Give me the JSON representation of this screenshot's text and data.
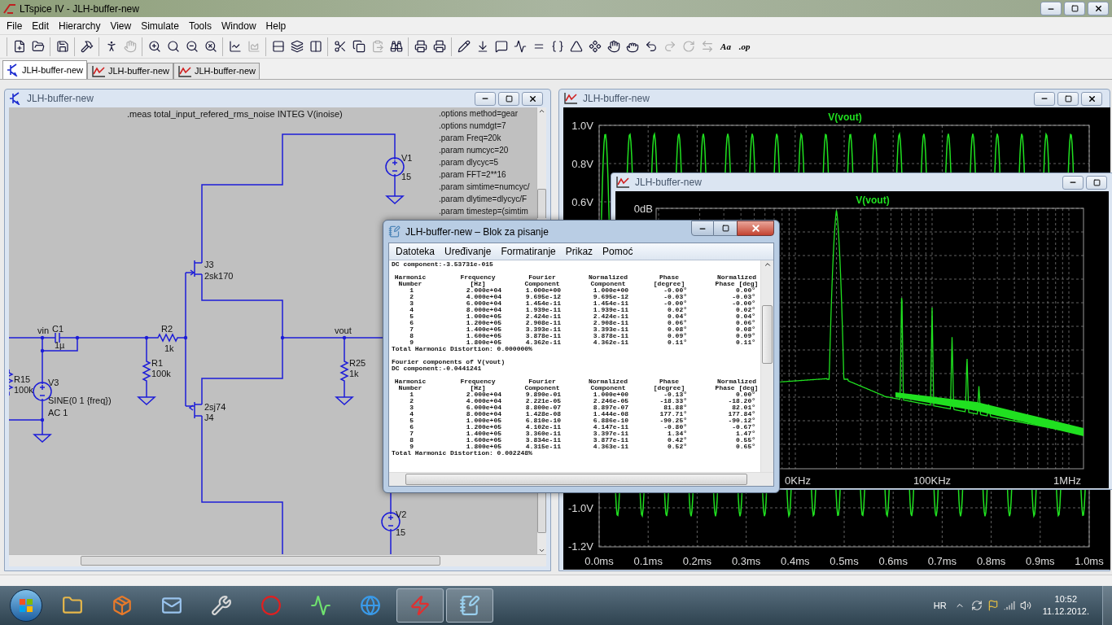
{
  "app_window": {
    "title": "LTspice IV - JLH-buffer-new"
  },
  "menu": [
    "File",
    "Edit",
    "Hierarchy",
    "View",
    "Simulate",
    "Tools",
    "Window",
    "Help"
  ],
  "toolbar_groups": [
    [
      {
        "kind": "new",
        "disabled": false
      },
      {
        "kind": "open",
        "disabled": false
      }
    ],
    [
      {
        "kind": "save",
        "disabled": false
      }
    ],
    [
      {
        "kind": "hammer",
        "disabled": false
      }
    ],
    [
      {
        "kind": "run",
        "disabled": false
      },
      {
        "kind": "halt",
        "disabled": true
      }
    ],
    [
      {
        "kind": "zoom_in",
        "disabled": false
      },
      {
        "kind": "pan",
        "disabled": false
      },
      {
        "kind": "zoom_out",
        "disabled": false
      },
      {
        "kind": "zoom_cancel",
        "disabled": false
      }
    ],
    [
      {
        "kind": "autorange",
        "disabled": false
      },
      {
        "kind": "traces",
        "disabled": true
      }
    ],
    [
      {
        "kind": "tile_h",
        "disabled": false
      },
      {
        "kind": "cascade",
        "disabled": false
      },
      {
        "kind": "tile_v",
        "disabled": false
      }
    ],
    [
      {
        "kind": "cut",
        "disabled": false
      },
      {
        "kind": "copy",
        "disabled": false
      },
      {
        "kind": "paste",
        "disabled": true
      },
      {
        "kind": "find",
        "disabled": false
      }
    ],
    [
      {
        "kind": "print_setup",
        "disabled": false
      },
      {
        "kind": "print",
        "disabled": false
      }
    ],
    [
      {
        "kind": "wire",
        "disabled": false
      },
      {
        "kind": "ground",
        "disabled": false
      },
      {
        "kind": "label",
        "disabled": false
      },
      {
        "kind": "resistor",
        "disabled": false
      },
      {
        "kind": "capacitor",
        "disabled": false
      },
      {
        "kind": "inductor",
        "disabled": false
      },
      {
        "kind": "diode",
        "disabled": false
      },
      {
        "kind": "component",
        "disabled": false
      },
      {
        "kind": "move",
        "disabled": false
      },
      {
        "kind": "drag",
        "disabled": false
      },
      {
        "kind": "undo",
        "disabled": false
      },
      {
        "kind": "redo",
        "disabled": true
      },
      {
        "kind": "rotate",
        "disabled": true
      },
      {
        "kind": "mirror",
        "disabled": true
      },
      {
        "kind": "text",
        "label": "Aa",
        "disabled": false
      },
      {
        "kind": "text",
        "label": ".op",
        "disabled": false
      }
    ]
  ],
  "tabs": [
    {
      "label": "JLH-buffer-new",
      "kind": "schematic",
      "selected": true
    },
    {
      "label": "JLH-buffer-new",
      "kind": "waveform",
      "selected": false
    },
    {
      "label": "JLH-buffer-new",
      "kind": "waveform",
      "selected": false
    }
  ],
  "schematic_window": {
    "title": "JLH-buffer-new",
    "measure_directive": ".meas total_input_refered_rms_noise INTEG V(inoise)",
    "spice_directives": [
      ".options method=gear",
      ".options numdgt=7",
      ".param Freq=20k",
      ".param numcyc=20",
      ".param dlycyc=5",
      ".param FFT=2**16",
      ".param simtime=numcyc/",
      ".param dlytime=dlycyc/F",
      ".param timestep=(simtim"
    ],
    "net_labels": [
      "vin",
      "vout"
    ],
    "components": [
      {
        "kind": "voltage_source",
        "name": "V1",
        "value": "15"
      },
      {
        "kind": "voltage_source",
        "name": "V2",
        "value": "15"
      },
      {
        "kind": "voltage_source",
        "name": "V3",
        "value": "SINE(0 1 {freq})",
        "extra": "AC 1"
      },
      {
        "kind": "njfet",
        "name": "J3",
        "value": "2sk170"
      },
      {
        "kind": "pjfet",
        "name": "J4",
        "value": "2sj74"
      },
      {
        "kind": "resistor_h",
        "name": "R2",
        "value": "1k"
      },
      {
        "kind": "resistor_v",
        "name": "R1",
        "value": "100k"
      },
      {
        "kind": "resistor_v",
        "name": "R25",
        "value": "1k"
      },
      {
        "kind": "resistor_v",
        "name": "R15",
        "value": "100k"
      },
      {
        "kind": "capacitor",
        "name": "C1",
        "value": "1µ"
      }
    ]
  },
  "waveform_window": {
    "title": "JLH-buffer-new",
    "trace": "V(vout)",
    "y_ticks": [
      "1.0V",
      "0.8V",
      "0.6V",
      "-1.0V",
      "-1.2V"
    ],
    "x_ticks": [
      "0.0ms",
      "0.1ms",
      "0.2ms",
      "0.3ms",
      "0.4ms",
      "0.5ms",
      "0.6ms",
      "0.7ms",
      "0.8ms",
      "0.9ms",
      "1.0ms"
    ]
  },
  "fft_window": {
    "title": "JLH-buffer-new",
    "trace": "V(vout)",
    "y_ticks": [
      "0dB"
    ],
    "x_ticks": [
      "0KHz",
      "100KHz",
      "1MHz"
    ]
  },
  "notepad": {
    "title": "JLH-buffer-new – Blok za pisanje",
    "menu": [
      "Datoteka",
      "Uređivanje",
      "Formatiranje",
      "Prikaz",
      "Pomoć"
    ],
    "sections": [
      {
        "dc": "DC component:-3.53731e-015",
        "columns": [
          {
            "title": "Harmonic",
            "unit": "Number"
          },
          {
            "title": "Frequency",
            "unit": "[Hz]"
          },
          {
            "title": "Fourier",
            "unit": "Component"
          },
          {
            "title": "Normalized",
            "unit": "Component"
          },
          {
            "title": "Phase",
            "unit": "[degree]"
          },
          {
            "title": "Normalized",
            "unit": "Phase [deg]"
          }
        ],
        "rows": [
          [
            "1",
            "2.000e+04",
            "1.000e+00",
            "1.000e+00",
            "-0.00°",
            "0.00°"
          ],
          [
            "2",
            "4.000e+04",
            "9.695e-12",
            "9.695e-12",
            "-0.03°",
            "-0.03°"
          ],
          [
            "3",
            "6.000e+04",
            "1.454e-11",
            "1.454e-11",
            "-0.00°",
            "-0.00°"
          ],
          [
            "4",
            "8.000e+04",
            "1.939e-11",
            "1.939e-11",
            "0.02°",
            "0.02°"
          ],
          [
            "5",
            "1.000e+05",
            "2.424e-11",
            "2.424e-11",
            "0.04°",
            "0.04°"
          ],
          [
            "6",
            "1.200e+05",
            "2.908e-11",
            "2.908e-11",
            "0.06°",
            "0.06°"
          ],
          [
            "7",
            "1.400e+05",
            "3.393e-11",
            "3.393e-11",
            "0.08°",
            "0.08°"
          ],
          [
            "8",
            "1.600e+05",
            "3.878e-11",
            "3.878e-11",
            "0.09°",
            "0.09°"
          ],
          [
            "9",
            "1.800e+05",
            "4.362e-11",
            "4.362e-11",
            "0.11°",
            "0.11°"
          ]
        ],
        "thd": "Total Harmonic Distortion: 0.000000%"
      },
      {
        "heading": "Fourier components of V(vout)",
        "dc": "DC component:-0.0441241",
        "columns": [
          {
            "title": "Harmonic",
            "unit": "Number"
          },
          {
            "title": "Frequency",
            "unit": "[Hz]"
          },
          {
            "title": "Fourier",
            "unit": "Component"
          },
          {
            "title": "Normalized",
            "unit": "Component"
          },
          {
            "title": "Phase",
            "unit": "[degree]"
          },
          {
            "title": "Normalized",
            "unit": "Phase [deg]"
          }
        ],
        "rows": [
          [
            "1",
            "2.000e+04",
            "9.890e-01",
            "1.000e+00",
            "-0.13°",
            "0.00°"
          ],
          [
            "2",
            "4.000e+04",
            "2.221e-05",
            "2.246e-05",
            "-18.33°",
            "-18.20°"
          ],
          [
            "3",
            "6.000e+04",
            "8.800e-07",
            "8.897e-07",
            "81.88°",
            "82.01°"
          ],
          [
            "4",
            "8.000e+04",
            "1.428e-08",
            "1.444e-08",
            "177.71°",
            "177.84°"
          ],
          [
            "5",
            "1.000e+05",
            "6.810e-10",
            "6.886e-10",
            "-90.25°",
            "-90.12°"
          ],
          [
            "6",
            "1.200e+05",
            "4.102e-11",
            "4.147e-11",
            "-0.80°",
            "-0.67°"
          ],
          [
            "7",
            "1.400e+05",
            "3.360e-11",
            "3.397e-11",
            "1.34°",
            "1.47°"
          ],
          [
            "8",
            "1.600e+05",
            "3.834e-11",
            "3.877e-11",
            "0.42°",
            "0.55°"
          ],
          [
            "9",
            "1.800e+05",
            "4.315e-11",
            "4.363e-11",
            "0.52°",
            "0.65°"
          ]
        ],
        "thd": "Total Harmonic Distortion: 0.002248%"
      }
    ]
  },
  "taskbar": {
    "buttons": [
      {
        "kind": "folder",
        "active": false
      },
      {
        "kind": "package",
        "active": false
      },
      {
        "kind": "mail",
        "active": false
      },
      {
        "kind": "wrench",
        "active": false
      },
      {
        "kind": "circle",
        "active": false
      },
      {
        "kind": "scope",
        "active": false
      },
      {
        "kind": "globe",
        "active": false
      },
      {
        "kind": "ltspice",
        "active": true
      },
      {
        "kind": "notepad",
        "active": true
      }
    ],
    "language": "HR",
    "time": "10:52",
    "date": "11.12.2012."
  }
}
